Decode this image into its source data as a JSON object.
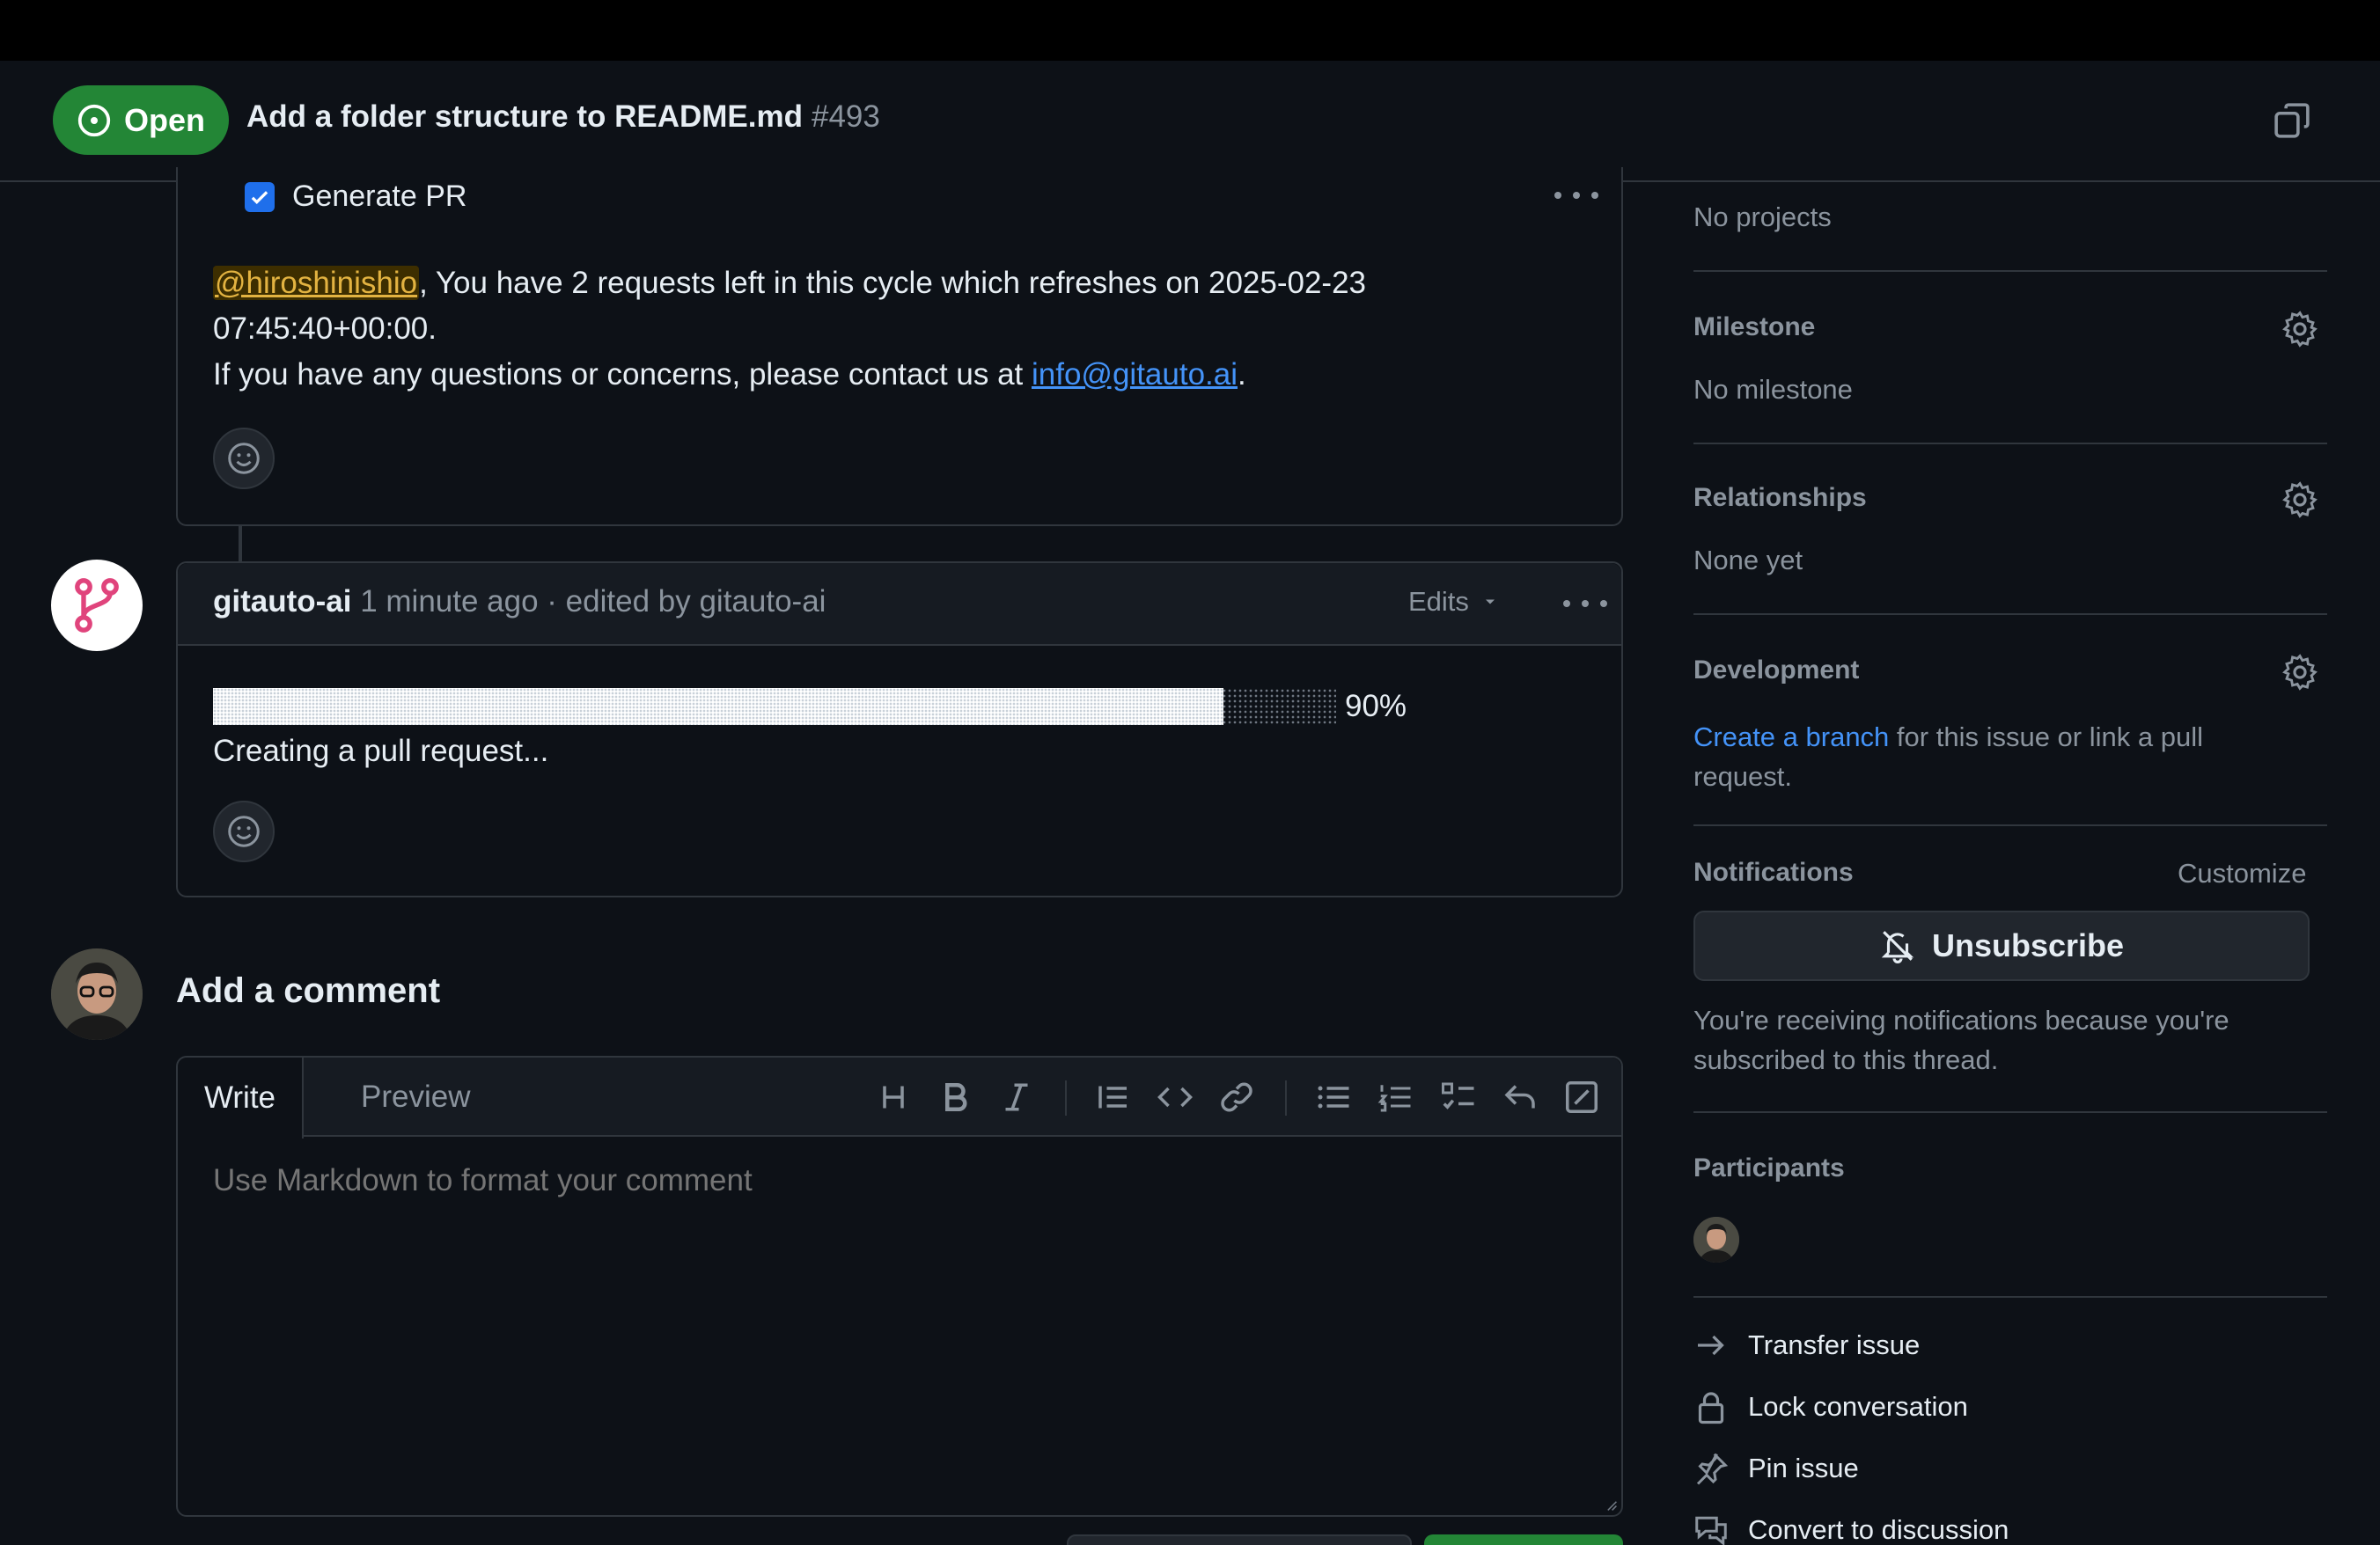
{
  "header": {
    "state": "Open",
    "title": "Add a folder structure to README.md",
    "number": "#493"
  },
  "comment1": {
    "checkbox_label": "Generate PR",
    "mention": "@hiroshinishio",
    "line1": ", You have 2 requests left in this cycle which refreshes on 2025-02-23",
    "line2": "07:45:40+00:00.",
    "line3_prefix": "If you have any questions or concerns, please contact us at ",
    "email": "info@gitauto.ai",
    "line3_suffix": "."
  },
  "comment2": {
    "author": "gitauto-ai",
    "meta": " 1 minute ago · edited by gitauto-ai",
    "edits_label": "Edits",
    "progress_percent": 90,
    "progress_label": "90%",
    "status": "Creating a pull request..."
  },
  "new_comment": {
    "heading": "Add a comment",
    "tab_write": "Write",
    "tab_preview": "Preview",
    "placeholder": "Use Markdown to format your comment"
  },
  "sidebar": {
    "projects_value": "No projects",
    "milestone_heading": "Milestone",
    "milestone_value": "No milestone",
    "relationships_heading": "Relationships",
    "relationships_value": "None yet",
    "development_heading": "Development",
    "development_link": "Create a branch",
    "development_text1": " for this issue or link a pull",
    "development_text2": "request.",
    "notifications_heading": "Notifications",
    "customize_label": "Customize",
    "unsubscribe_label": "Unsubscribe",
    "notif_reason1": "You're receiving notifications because you're",
    "notif_reason2": "subscribed to this thread.",
    "participants_heading": "Participants",
    "actions": [
      "Transfer issue",
      "Lock conversation",
      "Pin issue",
      "Convert to discussion"
    ]
  },
  "colors": {
    "open_green": "#238636",
    "link_blue": "#4493f8",
    "background": "#0d1117",
    "border": "#30363d"
  }
}
